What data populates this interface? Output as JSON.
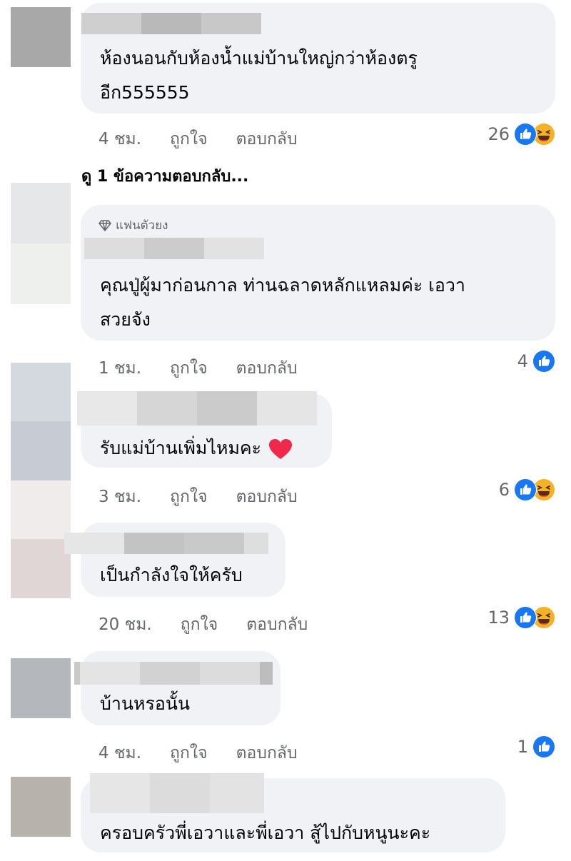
{
  "colors": {
    "bubble": "#f0f2f5",
    "meta_text": "#65676b",
    "like_blue": "#1877f2",
    "haha_yellow": "#f7b125",
    "heart_red": "#f02849"
  },
  "actions": {
    "like": "ถูกใจ",
    "reply": "ตอบกลับ"
  },
  "view_replies": "ดู 1 ข้อความตอบกลับ...",
  "comments": [
    {
      "lines": [
        "ห้องนอนกับห้องน้ำแม่บ้านใหญ่กว่าห้องตรู",
        "อีก555555"
      ],
      "time": "4 ชม.",
      "reaction_count": "26",
      "reactions": [
        "like-icon",
        "haha-icon"
      ]
    },
    {
      "badge": "แฟนตัวยง",
      "badge_icon": "diamond-icon",
      "lines": [
        "คุณปู่ผู้มาก่อนกาล ท่านฉลาดหลักแหลมค่ะ เอวา",
        "สวยจัง"
      ],
      "time": "1 ชม.",
      "reaction_count": "4",
      "reactions": [
        "like-icon"
      ]
    },
    {
      "lines": [
        "รับแม่บ้านเพิ่มไหมคะ"
      ],
      "emoji": "heart-icon",
      "time": "3 ชม.",
      "reaction_count": "6",
      "reactions": [
        "like-icon",
        "haha-icon"
      ]
    },
    {
      "lines": [
        "เป็นกำลังใจให้ครับ"
      ],
      "time": "20 ชม.",
      "reaction_count": "13",
      "reactions": [
        "like-icon",
        "haha-icon"
      ]
    },
    {
      "lines": [
        "บ้านหรอนั้น"
      ],
      "time": "4 ชม.",
      "reaction_count": "1",
      "reactions": [
        "like-icon"
      ]
    },
    {
      "lines": [
        "ครอบครัวพี่เอวาและพี่เอวา สู้ไปกับหนูนะคะ"
      ]
    }
  ]
}
